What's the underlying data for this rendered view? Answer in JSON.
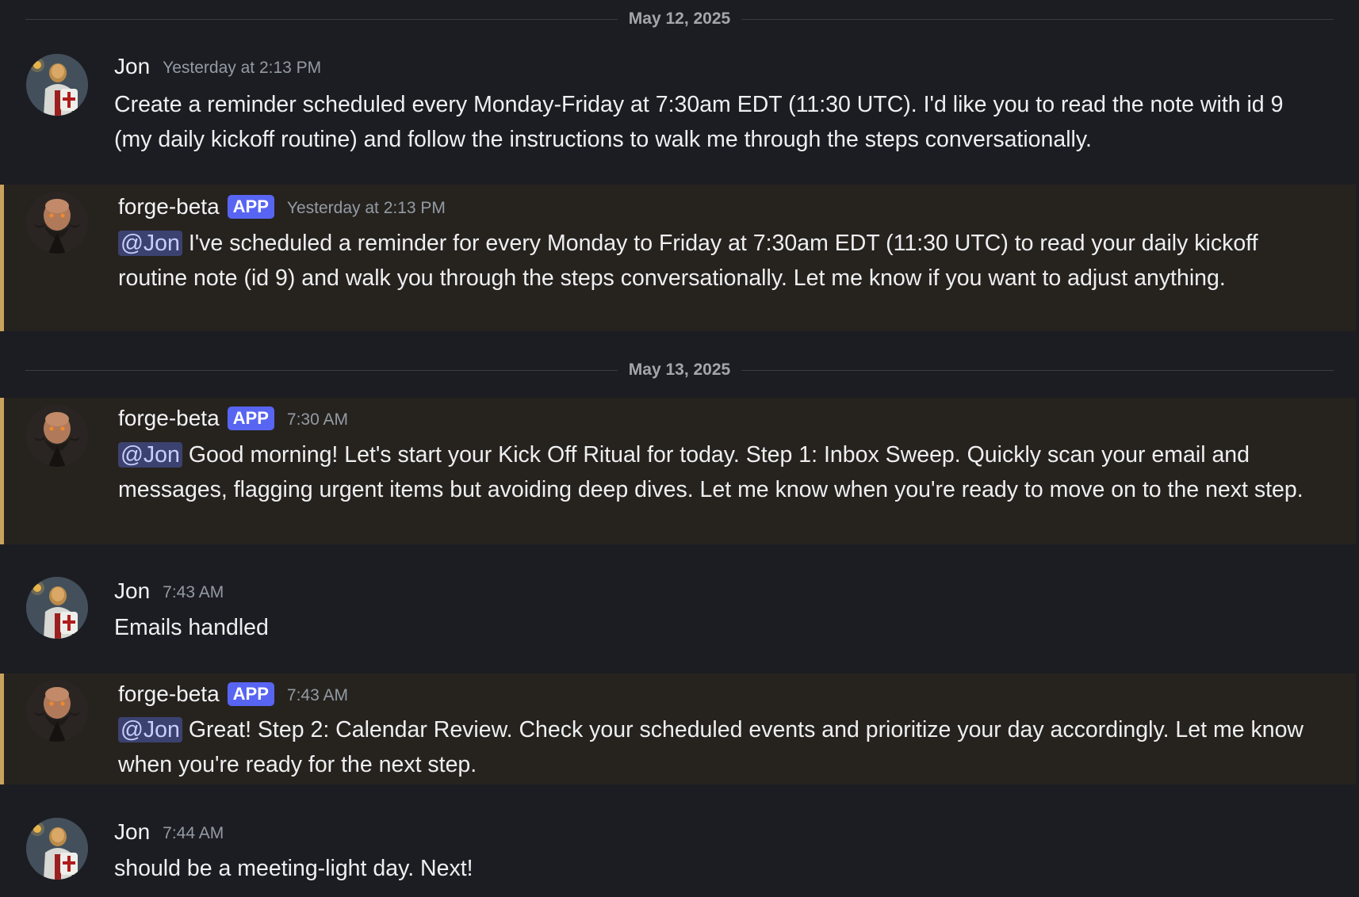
{
  "dates": {
    "first": "May 12, 2025",
    "second": "May 13, 2025"
  },
  "colors": {
    "background": "#1c1d22",
    "highlight_background": "#26231f",
    "highlight_border": "#c9a25d",
    "app_badge": "#5865f2",
    "mention_background": "#3c4270",
    "mention_text": "#c9cdfb"
  },
  "messages": [
    {
      "author": "Jon",
      "timestamp": "Yesterday at 2:13 PM",
      "avatar": "knight-lion-avatar",
      "text": "Create a reminder scheduled every Monday-Friday at 7:30am EDT (11:30 UTC). I'd like you to read the note with id 9 (my daily kickoff routine) and follow the instructions to walk me through the steps conversationally."
    },
    {
      "author": "forge-beta",
      "badge": "APP",
      "timestamp": "Yesterday at 2:13 PM",
      "avatar": "bearded-dwarf-avatar",
      "mention": "@Jon",
      "text": "I've scheduled a reminder for every Monday to Friday at 7:30am EDT (11:30 UTC) to read your daily kickoff routine note (id 9) and walk you through the steps conversationally. Let me know if you want to adjust anything."
    },
    {
      "author": "forge-beta",
      "badge": "APP",
      "timestamp": "7:30 AM",
      "avatar": "bearded-dwarf-avatar",
      "mention": "@Jon",
      "text": "Good morning! Let's start your Kick Off Ritual for today. Step 1: Inbox Sweep. Quickly scan your email and messages, flagging urgent items but avoiding deep dives. Let me know when you're ready to move on to the next step."
    },
    {
      "author": "Jon",
      "timestamp": "7:43 AM",
      "avatar": "knight-lion-avatar",
      "text": "Emails handled"
    },
    {
      "author": "forge-beta",
      "badge": "APP",
      "timestamp": "7:43 AM",
      "avatar": "bearded-dwarf-avatar",
      "mention": "@Jon",
      "text": "Great! Step 2: Calendar Review. Check your scheduled events and prioritize your day accordingly. Let me know when you're ready for the next step."
    },
    {
      "author": "Jon",
      "timestamp": "7:44 AM",
      "avatar": "knight-lion-avatar",
      "text": "should be a meeting-light day. Next!"
    }
  ]
}
